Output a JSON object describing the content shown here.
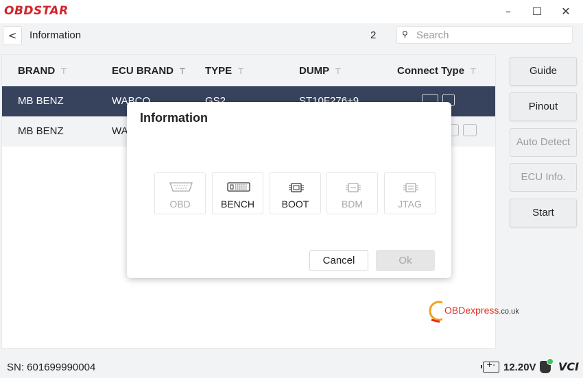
{
  "app": {
    "logo_text": "OBDSTAR",
    "window": {
      "minimize": "–",
      "maximize": "☐",
      "close": "✕"
    }
  },
  "header": {
    "back": "<",
    "title": "Information",
    "count": "2",
    "search_placeholder": "Search"
  },
  "table": {
    "columns": [
      {
        "label": "BRAND",
        "filter_icon": "filter-icon"
      },
      {
        "label": "ECU BRAND",
        "filter_icon": "filter-active-icon"
      },
      {
        "label": "TYPE",
        "filter_icon": "filter-icon"
      },
      {
        "label": "DUMP",
        "filter_icon": "filter-icon"
      },
      {
        "label": "Connect Type",
        "filter_icon": "filter-icon"
      }
    ],
    "rows": [
      {
        "brand": "MB BENZ",
        "ecu_brand": "WABCO",
        "type": "GS2",
        "dump": "ST10F276+9",
        "selected": true
      },
      {
        "brand": "MB BENZ",
        "ecu_brand": "WA",
        "type": "",
        "dump": "",
        "selected": false
      }
    ]
  },
  "side_buttons": {
    "guide": "Guide",
    "pinout": "Pinout",
    "auto_detect": "Auto Detect",
    "ecu_info": "ECU Info.",
    "start": "Start"
  },
  "modal": {
    "title": "Information",
    "connect_types": [
      {
        "label": "OBD",
        "enabled": false,
        "icon": "obd-connector-icon"
      },
      {
        "label": "BENCH",
        "enabled": true,
        "icon": "bench-connector-icon"
      },
      {
        "label": "BOOT",
        "enabled": true,
        "icon": "boot-chip-icon"
      },
      {
        "label": "BDM",
        "enabled": false,
        "icon": "bdm-chip-icon"
      },
      {
        "label": "JTAG",
        "enabled": false,
        "icon": "jtag-chip-icon"
      }
    ],
    "cancel": "Cancel",
    "ok": "Ok"
  },
  "watermark": {
    "part1": "OBD",
    "part2": "express",
    "part3": ".co.uk"
  },
  "footer": {
    "sn": "SN: 601699990004",
    "battery_sign": "+-",
    "voltage": "12.20V",
    "vci_logo": "VCI"
  },
  "colors": {
    "brand_red": "#d2232a",
    "selected_row": "#37435c",
    "status_green": "#3cc35a"
  }
}
